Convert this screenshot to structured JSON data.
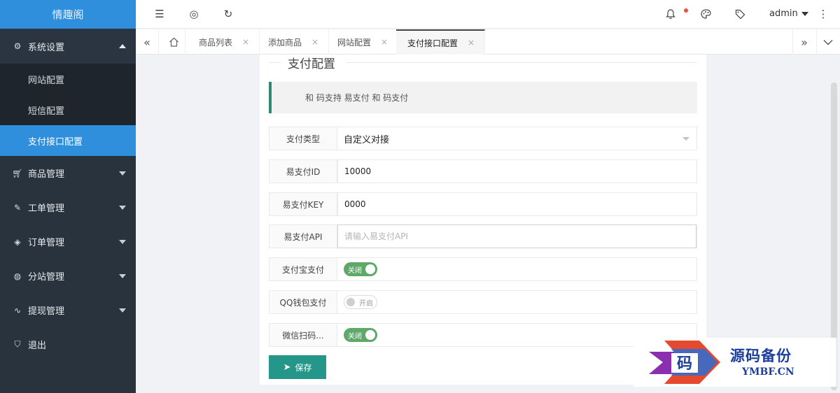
{
  "app": {
    "logo_text": "情趣阁"
  },
  "sidebar": {
    "items": [
      {
        "label": "系统设置",
        "icon": "gear-icon",
        "open": true
      },
      {
        "label": "商品管理",
        "icon": "cart-icon"
      },
      {
        "label": "工单管理",
        "icon": "ticket-icon"
      },
      {
        "label": "订单管理",
        "icon": "layers-icon"
      },
      {
        "label": "分站管理",
        "icon": "globe-icon"
      },
      {
        "label": "提现管理",
        "icon": "pulse-icon"
      },
      {
        "label": "退出",
        "icon": "shield-icon"
      }
    ],
    "submenu": [
      {
        "label": "网站配置"
      },
      {
        "label": "短信配置"
      },
      {
        "label": "支付接口配置",
        "active": true
      }
    ]
  },
  "header": {
    "icons": [
      "menu-fold-icon",
      "globe-icon",
      "refresh-icon",
      "bell-icon",
      "palette-icon",
      "tag-icon",
      "more-vertical-icon"
    ],
    "user": "admin"
  },
  "tabs": [
    {
      "label": "商品列表",
      "close": "×"
    },
    {
      "label": "添加商品",
      "close": "×"
    },
    {
      "label": "网站配置",
      "close": "×"
    },
    {
      "label": "支付接口配置",
      "close": "×",
      "active": true
    }
  ],
  "main": {
    "section_title": "支付配置",
    "notice": "和 码支持 易支付 和 码支付",
    "fields": {
      "pay_type": {
        "label": "支付类型",
        "value": "自定义对接"
      },
      "epay_id": {
        "label": "易支付ID",
        "value": "10000"
      },
      "epay_key": {
        "label": "易支付KEY",
        "value": "0000"
      },
      "epay_api": {
        "label": "易支付API",
        "value": "",
        "placeholder": "请输入易支付API"
      },
      "alipay": {
        "label": "支付宝支付",
        "switch_text": "关闭",
        "on": true
      },
      "qqpay": {
        "label": "QQ钱包支付",
        "switch_text": "开启",
        "on": false
      },
      "wxpay": {
        "label": "微信扫码...",
        "switch_text": "关闭",
        "on": true
      }
    },
    "save_label": "保存"
  },
  "watermark": {
    "cn": "源码备份",
    "en": "YMBF.CN",
    "glyph": "码"
  },
  "colors": {
    "sidebar_bg": "#28333e",
    "accent_blue": "#2f8fdc",
    "switch_green": "#5fa869",
    "save_teal": "#24978a",
    "notice_border": "#2a8b70",
    "watermark_blue": "#1d3f9b"
  }
}
